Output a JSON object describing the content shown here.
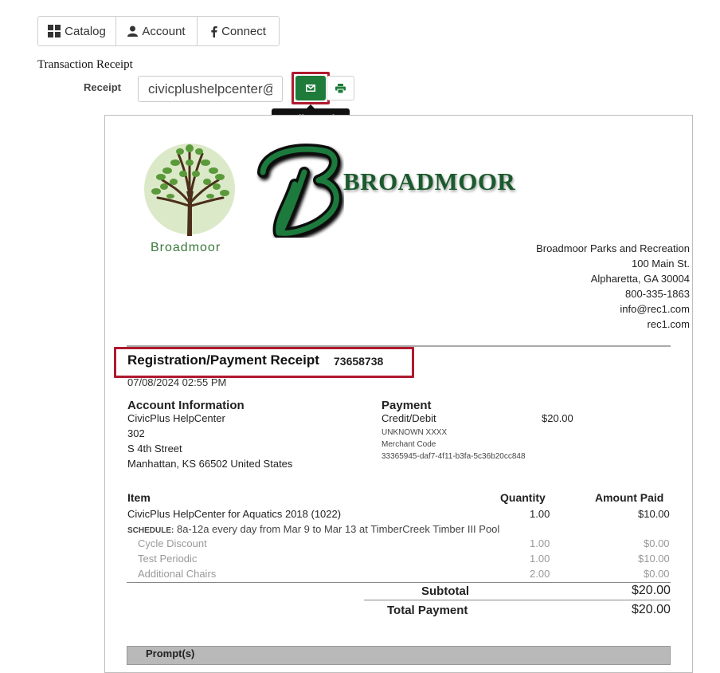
{
  "nav": {
    "items": [
      {
        "label": "Catalog",
        "icon": "grid-icon"
      },
      {
        "label": "Account",
        "icon": "user-icon"
      },
      {
        "label": "Connect",
        "icon": "facebook-icon"
      }
    ]
  },
  "page": {
    "heading": "Transaction Receipt",
    "receipt_label": "Receipt",
    "email_value": "civicplushelpcenter@",
    "tooltip": "Email Receipt"
  },
  "colors": {
    "accent_green": "#1e7b3a",
    "highlight_red": "#b0192f"
  },
  "receipt": {
    "logo_name": "Broadmoor",
    "logo_word": "BROADMOOR",
    "org": {
      "name": "Broadmoor Parks and Recreation",
      "street": "100 Main St.",
      "city": "Alpharetta, GA 30004",
      "phone": "800-335-1863",
      "email": "info@rec1.com",
      "web": "rec1.com"
    },
    "title": "Registration/Payment Receipt",
    "number": "73658738",
    "date": "07/08/2024 02:55 PM",
    "account": {
      "heading": "Account Information",
      "name": "CivicPlus HelpCenter",
      "line2": "302",
      "line3": "S 4th Street",
      "line4": "Manhattan, KS 66502 United States"
    },
    "payment": {
      "heading": "Payment",
      "method": "Credit/Debit",
      "amount": "$20.00",
      "card": "UNKNOWN XXXX",
      "merchant_label": "Merchant Code",
      "merchant_code": "33365945-daf7-4f11-b3fa-5c36b20cc848"
    },
    "items": {
      "col_item": "Item",
      "col_qty": "Quantity",
      "col_amount": "Amount Paid",
      "main": {
        "name": "CivicPlus HelpCenter for Aquatics 2018 (1022)",
        "qty": "1.00",
        "amount": "$10.00"
      },
      "schedule_label": "SCHEDULE:",
      "schedule_text": "8a-12a every day from Mar 9 to Mar 13 at TimberCreek Timber III Pool",
      "sub": [
        {
          "name": "Cycle Discount",
          "qty": "1.00",
          "amount": "$0.00"
        },
        {
          "name": "Test Periodic",
          "qty": "1.00",
          "amount": "$10.00"
        },
        {
          "name": "Additional Chairs",
          "qty": "2.00",
          "amount": "$0.00"
        }
      ]
    },
    "totals": {
      "subtotal_label": "Subtotal",
      "subtotal": "$20.00",
      "total_label": "Total Payment",
      "total": "$20.00"
    },
    "prompts_label": "Prompt(s)"
  }
}
